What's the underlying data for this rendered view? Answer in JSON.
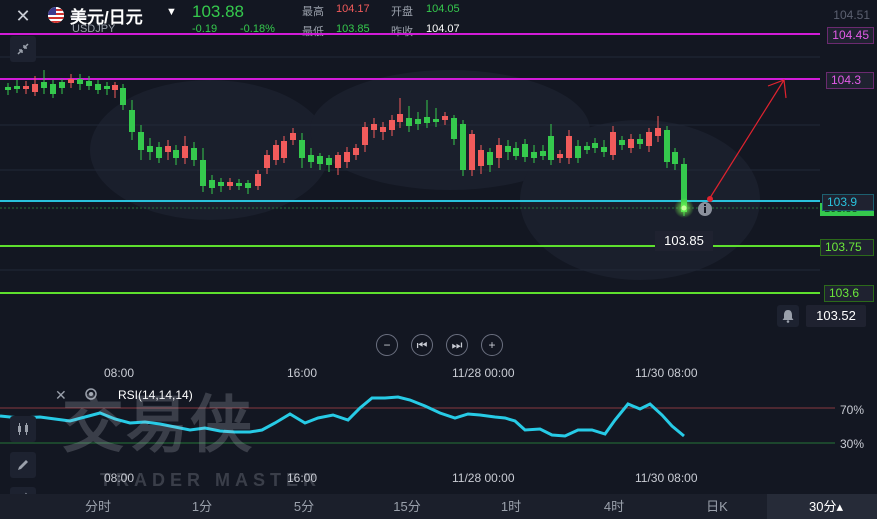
{
  "header": {
    "close_icon": "close-icon",
    "symbol_name": "美元/日元",
    "symbol_code": "USDJPY",
    "last_price": "103.88",
    "change": "-0.19",
    "change_pct": "-0.18%",
    "high_label": "最高",
    "high_value": "104.17",
    "open_label": "开盘",
    "open_value": "104.05",
    "low_label": "最低",
    "low_value": "103.85",
    "prev_close_label": "昨收",
    "prev_close_value": "104.07"
  },
  "price_axis": {
    "top_tick": "104.51",
    "level_104_45": "104.45",
    "level_104_3": "104.3",
    "level_103_9": "103.9",
    "hidden_tag": "103.88",
    "level_103_75": "103.75",
    "level_103_6": "103.6",
    "alert_price": "103.52",
    "low_annotation": "103.85"
  },
  "time_axis": {
    "t1": "08:00",
    "t2": "16:00",
    "t3": "11/28 00:00",
    "t4": "11/30 08:00"
  },
  "indicator": {
    "name": "RSI(14,14,14)",
    "level_high": "70%",
    "level_low": "30%"
  },
  "watermark": {
    "cn": "交易侠",
    "en": "TRADER MASTER"
  },
  "timeframes": [
    "分时",
    "1分",
    "5分",
    "15分",
    "1时",
    "4时",
    "日K",
    "30分▴"
  ],
  "colors": {
    "up": "#f15b5b",
    "down": "#35c94d",
    "magenta": "#d21cd8",
    "cyan": "#29c2dc",
    "green_line": "#5ee02e",
    "rsi": "#27cbe6"
  }
}
